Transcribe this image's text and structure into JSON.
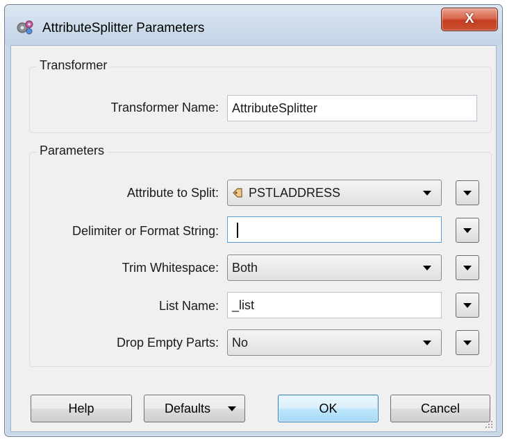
{
  "window": {
    "title": "AttributeSplitter Parameters",
    "close_label": "X"
  },
  "transformer_group": {
    "legend": "Transformer",
    "name_label": "Transformer Name:",
    "name_value": "AttributeSplitter"
  },
  "parameters_group": {
    "legend": "Parameters",
    "attribute_to_split": {
      "label": "Attribute to Split:",
      "value": "PSTLADDRESS"
    },
    "delimiter": {
      "label": "Delimiter or Format String:",
      "value": ""
    },
    "trim_whitespace": {
      "label": "Trim Whitespace:",
      "value": "Both"
    },
    "list_name": {
      "label": "List Name:",
      "value": "_list"
    },
    "drop_empty_parts": {
      "label": "Drop Empty Parts:",
      "value": "No"
    }
  },
  "buttons": {
    "help": "Help",
    "defaults": "Defaults",
    "ok": "OK",
    "cancel": "Cancel"
  },
  "icons": {
    "app": "gears-icon",
    "attribute": "attribute-tag-icon",
    "dropdown": "triangle-down-icon"
  },
  "colors": {
    "title_bar": "#c3d4e6",
    "close_button": "#c43e22",
    "dialog_background": "#f0f0f0",
    "default_button": "#a7d9f5"
  }
}
